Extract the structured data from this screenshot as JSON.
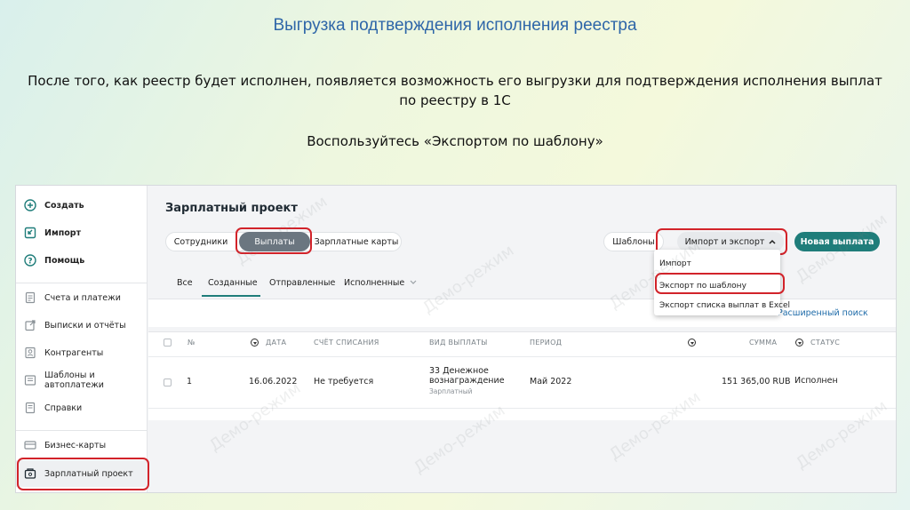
{
  "slide": {
    "title": "Выгрузка подтверждения исполнения реестра",
    "description": "После того, как реестр будет исполнен, появляется возможность его выгрузки для подтверждения исполнения выплат по реестру в 1С",
    "hint": "Воспользуйтесь «Экспортом по шаблону»"
  },
  "sidebar": {
    "top_items": [
      {
        "label": "Создать",
        "icon": "plus-circle-icon"
      },
      {
        "label": "Импорт",
        "icon": "import-icon"
      },
      {
        "label": "Помощь",
        "icon": "help-icon"
      }
    ],
    "items": [
      {
        "label": "Счета и платежи",
        "icon": "document-icon"
      },
      {
        "label": "Выписки и отчёты",
        "icon": "external-doc-icon"
      },
      {
        "label": "Контрагенты",
        "icon": "contacts-icon"
      },
      {
        "label": "Шаблоны и автоплатежи",
        "icon": "templates-icon"
      },
      {
        "label": "Справки",
        "icon": "certificate-icon"
      }
    ],
    "bottom_items": [
      {
        "label": "Бизнес-карты",
        "icon": "card-icon"
      },
      {
        "label": "Зарплатный проект",
        "icon": "salary-icon"
      }
    ]
  },
  "page": {
    "title": "Зарплатный проект",
    "segments": [
      "Сотрудники",
      "Выплаты",
      "Зарплатные карты"
    ],
    "templates_button": "Шаблоны",
    "import_export_button": "Импорт и экспорт",
    "new_payment_button": "Новая выплата",
    "dropdown": [
      "Импорт",
      "Экспорт по шаблону",
      "Экспорт списка выплат в Excel"
    ],
    "tabs": [
      "Все",
      "Созданные",
      "Отправленные",
      "Исполненные"
    ],
    "advanced_search": "Расширенный поиск"
  },
  "table": {
    "headers": {
      "num": "№",
      "date": "ДАТА",
      "account": "СЧЁТ СПИСАНИЯ",
      "type": "ВИД ВЫПЛАТЫ",
      "period": "ПЕРИОД",
      "sum": "СУММА",
      "status": "СТАТУС"
    },
    "rows": [
      {
        "num": "1",
        "date": "16.06.2022",
        "account": "Не требуется",
        "type_line1": "33 Денежное",
        "type_line2": "вознаграждение",
        "type_sub": "Зарплатный",
        "period": "Май 2022",
        "sum": "151 365,00 RUB",
        "status": "Исполнен"
      }
    ]
  },
  "watermark": "Демо-режим",
  "colors": {
    "accent": "#1f7d7a",
    "highlight": "#d2232a",
    "title": "#2e66a8",
    "link": "#1c6aa8"
  }
}
